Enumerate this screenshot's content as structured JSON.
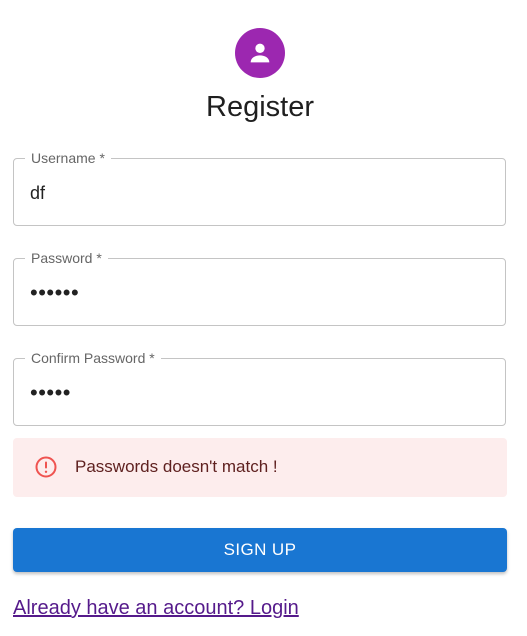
{
  "header": {
    "icon": "person-icon",
    "title": "Register"
  },
  "form": {
    "username": {
      "label": "Username *",
      "value": "df"
    },
    "password": {
      "label": "Password *",
      "value": "••••••"
    },
    "confirm_password": {
      "label": "Confirm Password *",
      "value": "•••••"
    }
  },
  "alert": {
    "icon": "error-outline-icon",
    "message": "Passwords doesn't match !"
  },
  "actions": {
    "submit_label": "SIGN UP",
    "login_link": "Already have an account? Login"
  },
  "colors": {
    "avatar": "#9c27b0",
    "primary": "#1976d2",
    "alert_bg": "#fdeded",
    "alert_icon": "#ef5350",
    "alert_text": "#5f2120",
    "link": "#551a8b"
  }
}
